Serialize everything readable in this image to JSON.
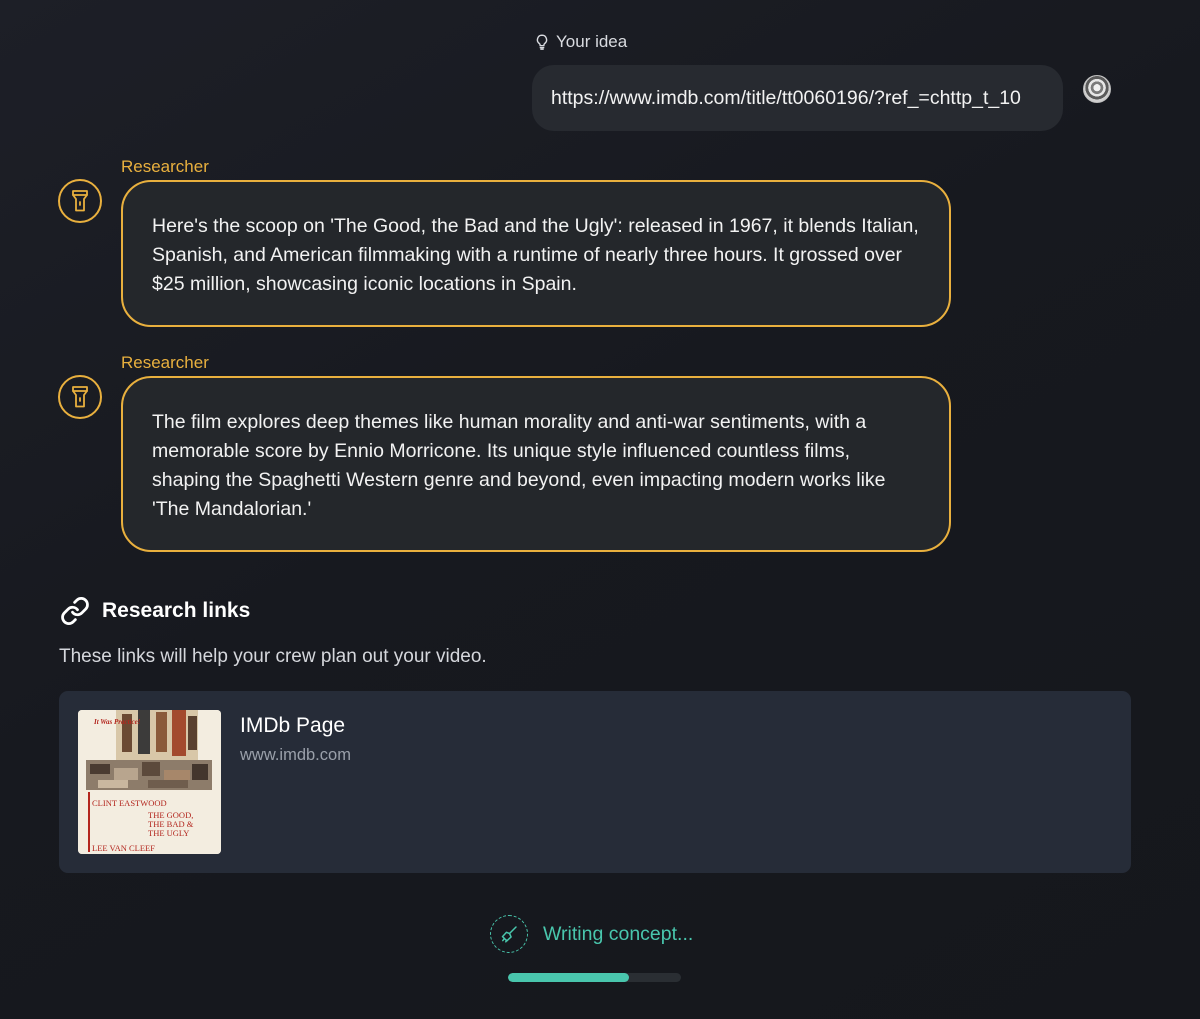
{
  "user_message": {
    "label": "Your idea",
    "text": "https://www.imdb.com/title/tt0060196/?ref_=chttp_t_10"
  },
  "agent_messages": [
    {
      "author": "Researcher",
      "text": "Here's the scoop on 'The Good, the Bad and the Ugly': released in 1967, it blends Italian, Spanish, and American filmmaking with a runtime of nearly three hours. It grossed over $25 million, showcasing iconic locations in Spain."
    },
    {
      "author": "Researcher",
      "text": "The film explores deep themes like human morality and anti-war sentiments, with a memorable score by Ennio Morricone. Its unique style influenced countless films, shaping the Spaghetti Western genre and beyond, even impacting modern works like 'The Mandalorian.'"
    }
  ],
  "research_links": {
    "heading": "Research links",
    "description": "These links will help your crew plan out your video.",
    "items": [
      {
        "title": "IMDb Page",
        "domain": "www.imdb.com",
        "thumbnail": {
          "corner_text": "It Was Practice!",
          "credit_top": "CLINT EASTWOOD",
          "title_lines": [
            "THE GOOD,",
            "THE BAD &",
            "THE UGLY"
          ],
          "credit_bottom": "LEE VAN CLEEF"
        }
      }
    ]
  },
  "status": {
    "text": "Writing concept...",
    "progress": 0.7
  },
  "colors": {
    "accent_agent": "#e9b03e",
    "accent_status": "#49c6ad",
    "bubble_user": "#272a30",
    "bubble_agent": "#24272b",
    "card": "#262c38"
  },
  "icons": {
    "user_label": "lightbulb-icon",
    "agent": "flashlight-icon",
    "links": "link-icon",
    "status": "broom-icon"
  }
}
